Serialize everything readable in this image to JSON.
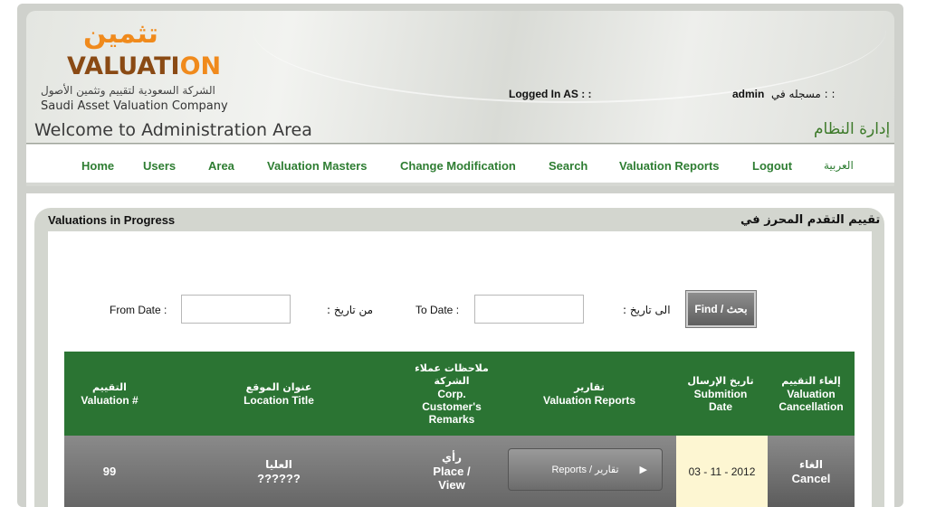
{
  "brand": {
    "logo_ar": "تثمين",
    "logo_en_part1": "VALUATI",
    "logo_en_part2": "ON",
    "company_ar": "الشركة السعودية لتقييم وتثمين الأصول",
    "company_en": "Saudi Asset Valuation Company"
  },
  "header": {
    "logged_in_label": "Logged In AS : :",
    "user": "admin",
    "logged_in_ar": ": : مسجله في",
    "welcome": "Welcome to Administration Area",
    "welcome_ar": "إدارة النظام"
  },
  "nav": {
    "items": [
      "Home",
      "Users",
      "Area",
      "Valuation Masters",
      "Change Modification",
      "Search",
      "Valuation Reports",
      "Logout"
    ],
    "language": "العربية"
  },
  "panel": {
    "title": "Valuations in Progress",
    "title_ar": "تقييم التقدم المحرز في"
  },
  "filter": {
    "from_label": "From Date :",
    "from_label_ar": "من تاريخ :",
    "from_value": "",
    "to_label": "To Date :",
    "to_label_ar": "الى تاريخ :",
    "to_value": "",
    "find_button": "Find / بحث"
  },
  "table": {
    "headers": [
      {
        "ar": "التقييم",
        "en": "Valuation #"
      },
      {
        "ar": "عنوان الموقع",
        "en": "Location Title"
      },
      {
        "ar": "ملاحظات عملاء الشركة",
        "en": "Corp. Customer's Remarks"
      },
      {
        "ar": "تقارير",
        "en": "Valuation Reports"
      },
      {
        "ar": "تاريخ الإرسال",
        "en": "Submition Date"
      },
      {
        "ar": "إلغاء التقييم",
        "en": "Valuation Cancellation"
      }
    ],
    "rows": [
      {
        "valuation_no": "99",
        "location_ar": "العليا",
        "location_en": "??????",
        "remarks_ar": "رأي",
        "remarks_en1": "Place /",
        "remarks_en2": "View",
        "reports_button": "Reports / تقارير",
        "date": "03 - 11 - 2012",
        "cancel_ar": "الغاء",
        "cancel_en": "Cancel"
      }
    ]
  }
}
